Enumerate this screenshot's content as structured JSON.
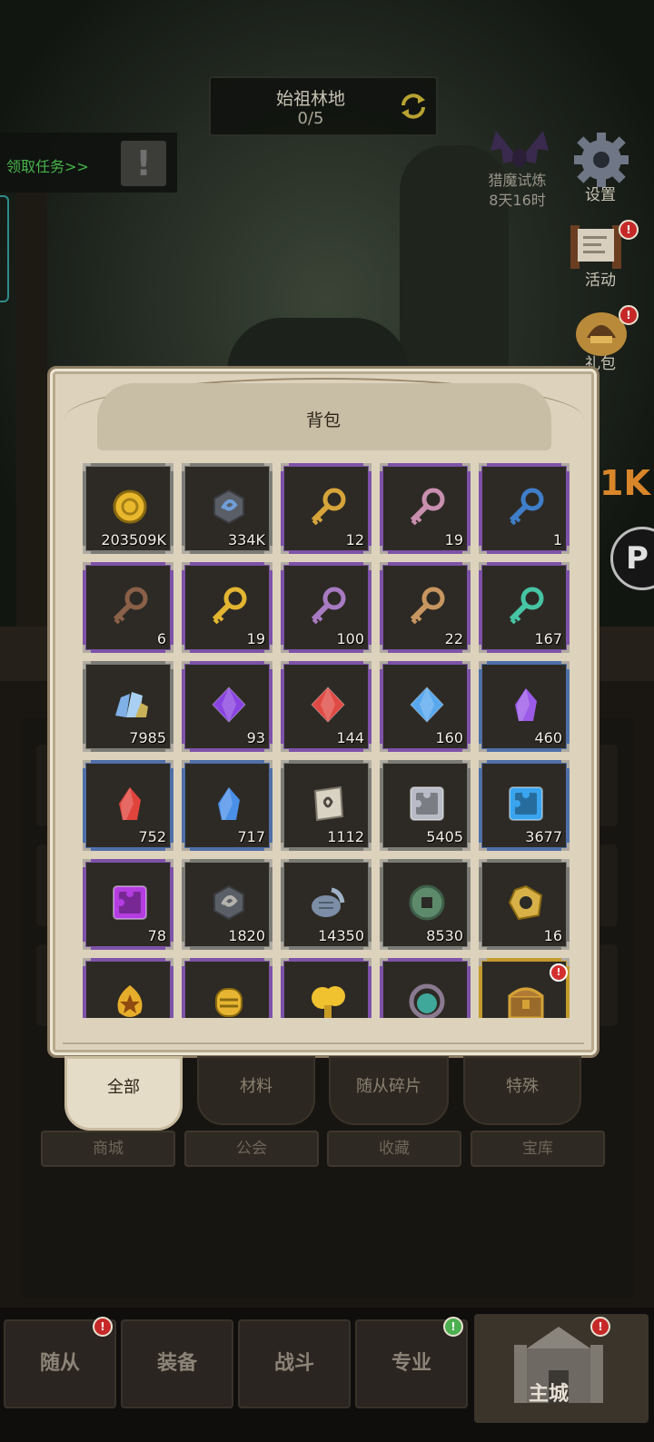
{
  "hud": {
    "stage_title": "始祖林地",
    "stage_progress": "0/5",
    "quest_text": "领取任务>>",
    "hunt_label": "猎魔试炼",
    "hunt_timer": "8天16时",
    "settings_label": "设置",
    "activity_label": "活动",
    "gift_label": "礼包",
    "partial_banner": "1K",
    "round_button_letter": "P"
  },
  "backpack": {
    "title": "背包",
    "items": [
      {
        "icon": "gold-coin",
        "count": "203509K",
        "rarity": "grey",
        "color": "#e9b82d"
      },
      {
        "icon": "blue-rune-stone",
        "count": "334K",
        "rarity": "grey",
        "color": "#6f9ed8"
      },
      {
        "icon": "gold-key",
        "count": "12",
        "rarity": "purple",
        "color": "#d6a43a"
      },
      {
        "icon": "pink-key",
        "count": "19",
        "rarity": "purple",
        "color": "#c98fae"
      },
      {
        "icon": "blue-key",
        "count": "1",
        "rarity": "purple",
        "color": "#3f7ec9"
      },
      {
        "icon": "bronze-key",
        "count": "6",
        "rarity": "purple",
        "color": "#8a6048"
      },
      {
        "icon": "ornate-gold-key",
        "count": "19",
        "rarity": "purple",
        "color": "#e3b531"
      },
      {
        "icon": "violet-key",
        "count": "100",
        "rarity": "purple",
        "color": "#a77ac2"
      },
      {
        "icon": "tan-key",
        "count": "22",
        "rarity": "purple",
        "color": "#c89660"
      },
      {
        "icon": "teal-key",
        "count": "167",
        "rarity": "purple",
        "color": "#46c4a4"
      },
      {
        "icon": "blue-crystal-cluster",
        "count": "7985",
        "rarity": "grey",
        "color": "#7fb0e6"
      },
      {
        "icon": "purple-gem",
        "count": "93",
        "rarity": "purple",
        "color": "#8a44e0"
      },
      {
        "icon": "red-gem",
        "count": "144",
        "rarity": "purple",
        "color": "#e04a44"
      },
      {
        "icon": "blue-gem",
        "count": "160",
        "rarity": "purple",
        "color": "#59a8ee"
      },
      {
        "icon": "purple-crystal",
        "count": "460",
        "rarity": "blue",
        "color": "#9c5ae8"
      },
      {
        "icon": "red-crystal",
        "count": "752",
        "rarity": "blue",
        "color": "#e0443c"
      },
      {
        "icon": "blue-crystal",
        "count": "717",
        "rarity": "blue",
        "color": "#4a8fe8"
      },
      {
        "icon": "scroll",
        "count": "1112",
        "rarity": "grey",
        "color": "#d9d3c4"
      },
      {
        "icon": "grey-puzzle-box",
        "count": "5405",
        "rarity": "grey",
        "color": "#b9bcc6"
      },
      {
        "icon": "blue-puzzle-box",
        "count": "3677",
        "rarity": "blue",
        "color": "#3aa4ee"
      },
      {
        "icon": "purple-puzzle-box",
        "count": "78",
        "rarity": "purple",
        "color": "#b43ce0"
      },
      {
        "icon": "grey-rune-stone",
        "count": "1820",
        "rarity": "grey",
        "color": "#b4b2ac"
      },
      {
        "icon": "fish-fossil",
        "count": "14350",
        "rarity": "grey",
        "color": "#7c8ea6"
      },
      {
        "icon": "jade-coin",
        "count": "8530",
        "rarity": "grey",
        "color": "#5e8a6c"
      },
      {
        "icon": "gold-nut",
        "count": "16",
        "rarity": "grey",
        "color": "#d8b048"
      },
      {
        "icon": "star-badge",
        "count": "",
        "rarity": "purple",
        "color": "#e6ad2a"
      },
      {
        "icon": "gold-capsule",
        "count": "",
        "rarity": "purple",
        "color": "#e8b532"
      },
      {
        "icon": "gold-mushroom",
        "count": "",
        "rarity": "purple",
        "color": "#f0c230"
      },
      {
        "icon": "teal-orb",
        "count": "",
        "rarity": "purple",
        "color": "#3fa89a"
      },
      {
        "icon": "treasure-chest",
        "count": "",
        "rarity": "gold",
        "color": "#d4a236",
        "alert": true
      }
    ]
  },
  "tabs": [
    {
      "label": "全部",
      "active": true
    },
    {
      "label": "材料",
      "active": false
    },
    {
      "label": "随从碎片",
      "active": false
    },
    {
      "label": "特殊",
      "active": false
    }
  ],
  "lower_buttons": [
    "商城",
    "公会",
    "收藏",
    "宝库"
  ],
  "bottom_nav": [
    {
      "label": "随从",
      "badge": "!"
    },
    {
      "label": "装备",
      "badge": ""
    },
    {
      "label": "战斗",
      "badge": ""
    },
    {
      "label": "专业",
      "badge": "!"
    },
    {
      "label": "主城",
      "badge": "!"
    }
  ]
}
